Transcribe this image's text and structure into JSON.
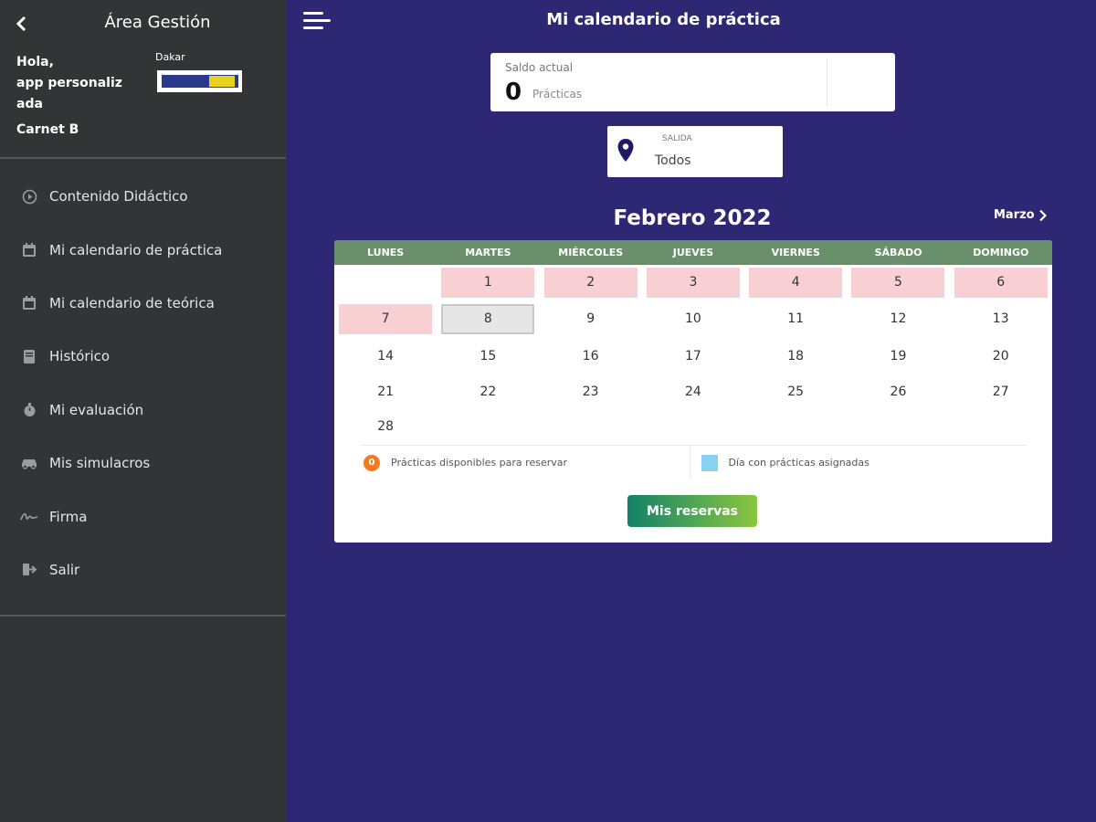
{
  "sidebar": {
    "title": "Área Gestión",
    "greeting": "Hola,",
    "user_name": "app personalizada",
    "license": "Carnet B",
    "school_name": "Dakar",
    "items": [
      {
        "label": "Contenido Didáctico",
        "icon": "play-circle-icon"
      },
      {
        "label": "Mi calendario de práctica",
        "icon": "calendar-icon"
      },
      {
        "label": "Mi calendario de teórica",
        "icon": "calendar-icon"
      },
      {
        "label": "Histórico",
        "icon": "book-icon"
      },
      {
        "label": "Mi evaluación",
        "icon": "stopwatch-icon"
      },
      {
        "label": "Mis simulacros",
        "icon": "car-icon"
      },
      {
        "label": "Firma",
        "icon": "signature-icon"
      },
      {
        "label": "Salir",
        "icon": "logout-icon"
      }
    ]
  },
  "header": {
    "title": "Mi calendario de práctica"
  },
  "balance": {
    "label": "Saldo actual",
    "value": "0",
    "unit": "Prácticas"
  },
  "exit_point": {
    "label": "SALIDA",
    "value": "Todos"
  },
  "calendar": {
    "month_title": "Febrero 2022",
    "next_label": "Marzo",
    "weekdays": [
      "LUNES",
      "MARTES",
      "MIÉRCOLES",
      "JUEVES",
      "VIERNES",
      "SÁBADO",
      "DOMINGO"
    ],
    "rows": [
      [
        "",
        "1",
        "2",
        "3",
        "4",
        "5",
        "6"
      ],
      [
        "7",
        "8",
        "9",
        "10",
        "11",
        "12",
        "13"
      ],
      [
        "14",
        "15",
        "16",
        "17",
        "18",
        "19",
        "20"
      ],
      [
        "21",
        "22",
        "23",
        "24",
        "25",
        "26",
        "27"
      ],
      [
        "28",
        "",
        "",
        "",
        "",
        "",
        ""
      ]
    ],
    "highlighted_days": [
      "1",
      "2",
      "3",
      "4",
      "5",
      "6",
      "7"
    ],
    "today": "8",
    "highlight_color": "#f8cfd3",
    "today_color": "#e6e6e6"
  },
  "legend": {
    "available_badge": "0",
    "available_label": "Prácticas disponibles para reservar",
    "assigned_label": "Día con prácticas asignadas",
    "available_color": "#f47a20",
    "assigned_color": "#87d2f2"
  },
  "actions": {
    "reservations_label": "Mis reservas"
  },
  "colors": {
    "background": "#2e2874",
    "sidebar": "#333435",
    "calendar_header": "#6a8f6b"
  }
}
